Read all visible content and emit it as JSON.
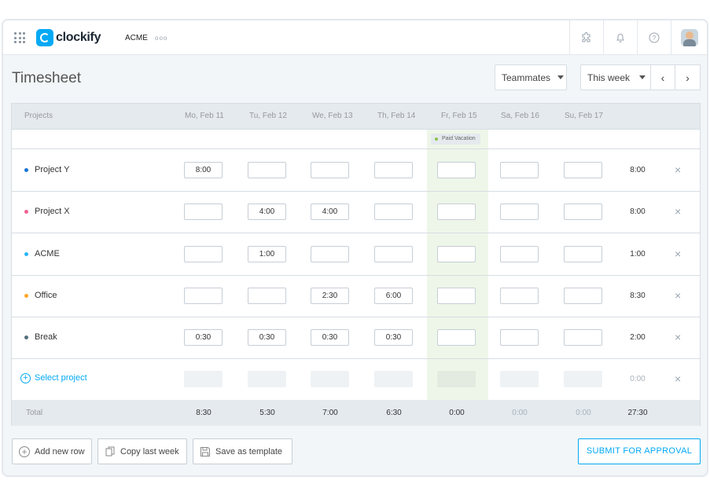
{
  "app": {
    "brand": "clockify",
    "workspace": "ACME",
    "workspace_more": "ooo"
  },
  "topbar_icons": [
    "puzzle-icon",
    "bell-icon",
    "help-icon"
  ],
  "page": {
    "title": "Timesheet"
  },
  "filters": {
    "teammates_label": "Teammates",
    "week_label": "This week",
    "prev": "‹",
    "next": "›"
  },
  "grid": {
    "project_header": "Projects",
    "days": [
      "Mo, Feb 11",
      "Tu, Feb 12",
      "We, Feb 13",
      "Th, Feb 14",
      "Fr, Feb 15",
      "Sa, Feb 16",
      "Su, Feb 17"
    ],
    "vacation_badge": "Paid Vacation",
    "rows": [
      {
        "name": "Project Y",
        "color": "#1976d2",
        "cells": [
          "8:00",
          "",
          "",
          "",
          "",
          "",
          ""
        ],
        "total": "8:00"
      },
      {
        "name": "Project X",
        "color": "#f06292",
        "cells": [
          "",
          "4:00",
          "4:00",
          "",
          "",
          "",
          ""
        ],
        "total": "8:00"
      },
      {
        "name": "ACME",
        "color": "#29b6f6",
        "cells": [
          "",
          "1:00",
          "",
          "",
          "",
          "",
          ""
        ],
        "total": "1:00"
      },
      {
        "name": "Office",
        "color": "#ffa726",
        "cells": [
          "",
          "",
          "2:30",
          "6:00",
          "",
          "",
          ""
        ],
        "total": "8:30"
      },
      {
        "name": "Break",
        "color": "#546e7a",
        "cells": [
          "0:30",
          "0:30",
          "0:30",
          "0:30",
          "",
          "",
          ""
        ],
        "total": "2:00"
      }
    ],
    "select_project": {
      "icon": "+",
      "label": "Select project",
      "total": "0:00"
    },
    "footer": {
      "label": "Total",
      "totals": [
        "8:30",
        "5:30",
        "7:00",
        "6:30",
        "0:00",
        "0:00",
        "0:00"
      ],
      "grand_total": "27:30"
    },
    "delete_symbol": "×"
  },
  "actions": {
    "add_row": "Add new row",
    "copy_week": "Copy last week",
    "save_template": "Save as template",
    "submit": "SUBMIT FOR APPROVAL"
  }
}
